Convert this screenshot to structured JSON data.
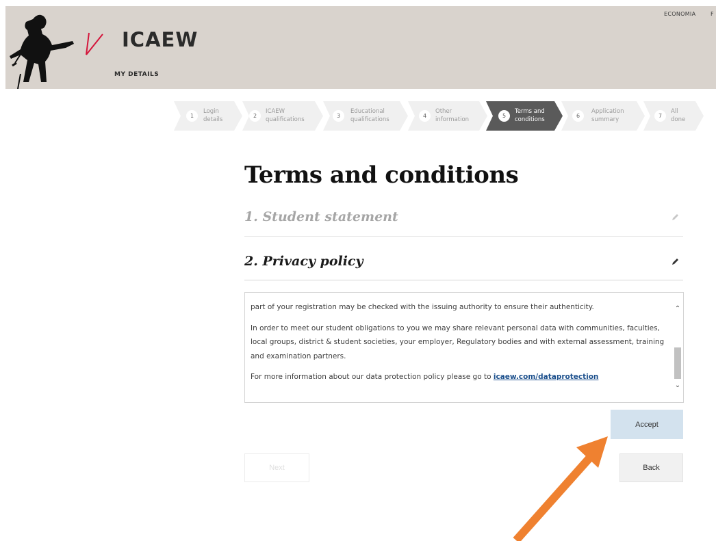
{
  "header": {
    "brand": "ICAEW",
    "section": "MY DETAILS",
    "top_links": [
      "ECONOMIA",
      "F"
    ]
  },
  "steps": [
    {
      "number": "1",
      "label": "Login\ndetails",
      "state": "inactive"
    },
    {
      "number": "2",
      "label": "ICAEW\nqualifications",
      "state": "inactive"
    },
    {
      "number": "3",
      "label": "Educational\nqualifications",
      "state": "inactive"
    },
    {
      "number": "4",
      "label": "Other\ninformation",
      "state": "inactive"
    },
    {
      "number": "5",
      "label": "Terms and\nconditions",
      "state": "active"
    },
    {
      "number": "6",
      "label": "Application\nsummary",
      "state": "inactive"
    },
    {
      "number": "7",
      "label": "All\ndone",
      "state": "inactive"
    }
  ],
  "main": {
    "title": "Terms and conditions",
    "sections": [
      {
        "title": "1. Student statement",
        "icon": "pencil-icon"
      },
      {
        "title": "2. Privacy policy",
        "icon": "pencil-icon"
      }
    ],
    "policy": {
      "para1": "part of your registration may be checked with the issuing authority to ensure their authenticity.",
      "para2": "In order to meet our student obligations to you we may share relevant personal data with communities, faculties, local groups, district & student societies, your employer, Regulatory bodies and with external assessment, training and examination partners.",
      "para3_prefix": "For more information about our data protection policy please go to ",
      "para3_link": "icaew.com/dataprotection"
    },
    "accept_label": "Accept",
    "next_label": "Next",
    "back_label": "Back"
  },
  "colors": {
    "header_bg": "#d9d3cd",
    "active_step": "#5a5a5a",
    "inactive_step": "#f0f0f0",
    "accept_bg": "#d3e2ee",
    "link": "#1b4f8c",
    "annotation_arrow": "#ef8130"
  }
}
